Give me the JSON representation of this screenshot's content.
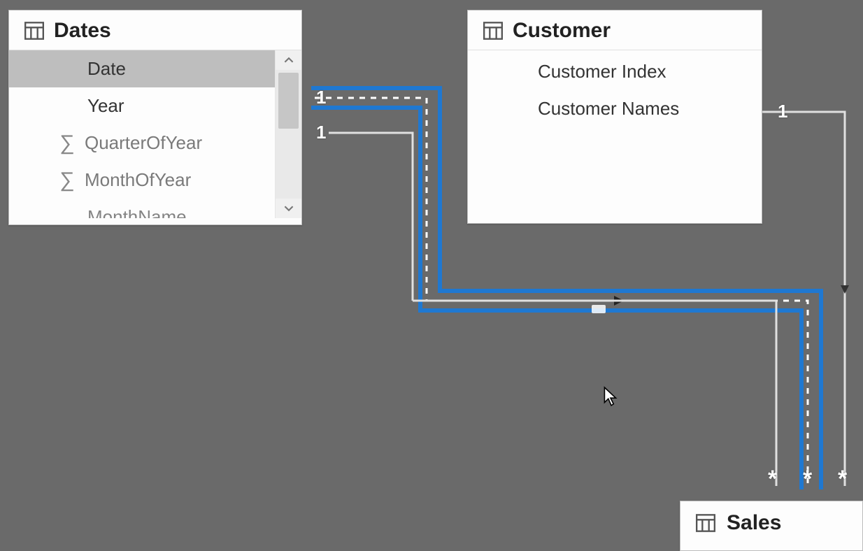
{
  "tables": {
    "dates": {
      "title": "Dates",
      "fields": {
        "date": "Date",
        "year": "Year",
        "quarterOfYear": "QuarterOfYear",
        "monthOfYear": "MonthOfYear",
        "monthName": "MonthName"
      }
    },
    "customer": {
      "title": "Customer",
      "fields": {
        "customerIndex": "Customer Index",
        "customerNames": "Customer Names"
      }
    },
    "sales": {
      "title": "Sales"
    }
  },
  "relationships": {
    "one_a": "1",
    "one_b": "1",
    "one_c": "1",
    "many_a": "*",
    "many_b": "*",
    "many_c": "*"
  },
  "colors": {
    "selected_relationship": "#1f78d1",
    "line": "#d9d9d9",
    "canvas": "#6a6a6a"
  }
}
